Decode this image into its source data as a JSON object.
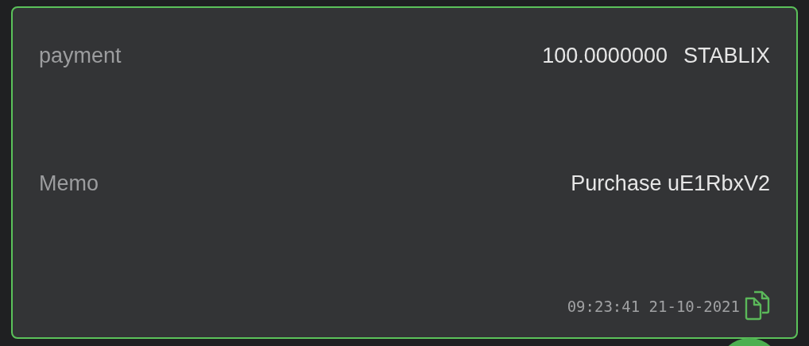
{
  "rows": [
    {
      "label": "payment",
      "value": "100.0000000",
      "unit": "STABLIX"
    },
    {
      "label": "Memo",
      "value": "Purchase uE1RbxV2"
    }
  ],
  "timestamp": "09:23:41 21-10-2021"
}
